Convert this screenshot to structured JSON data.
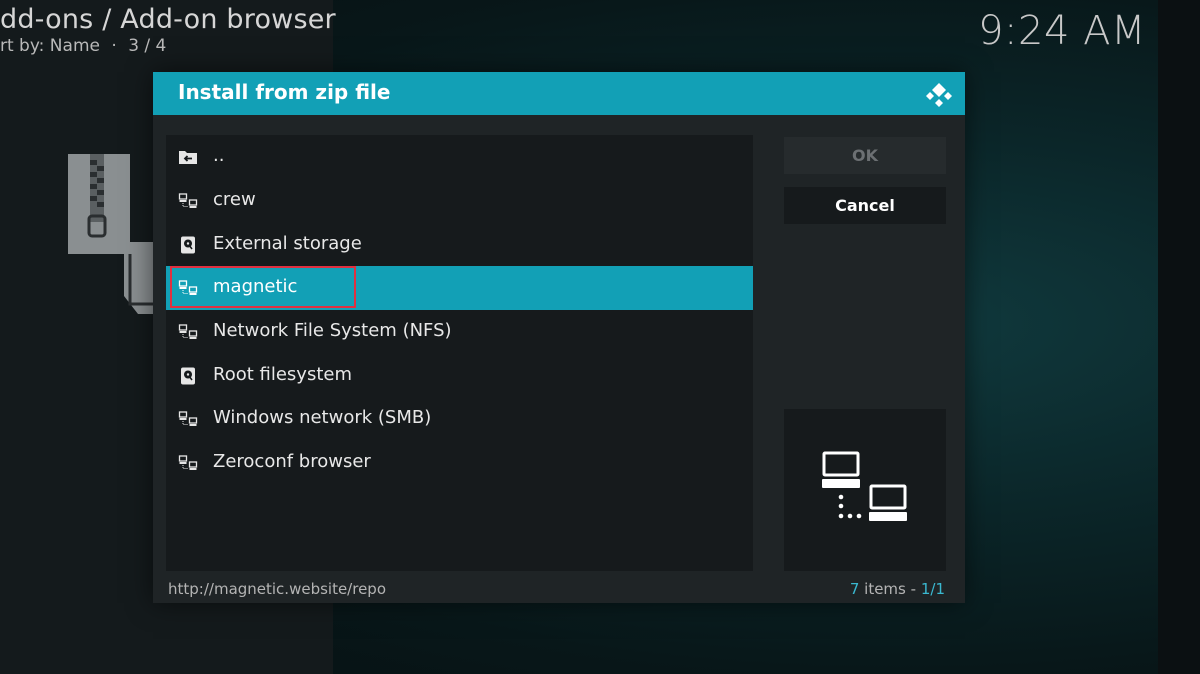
{
  "header": {
    "title": "dd-ons / Add-on browser",
    "sort_text": "rt by: Name",
    "separator": "·",
    "position": "3 / 4",
    "clock": "9:24 AM"
  },
  "dialog": {
    "title": "Install from zip file",
    "logo_icon": "kodi-logo-icon",
    "items": [
      {
        "label": "..",
        "icon": "folder-back-icon"
      },
      {
        "label": "crew",
        "icon": "network-icon"
      },
      {
        "label": "External storage",
        "icon": "hard-drive-icon"
      },
      {
        "label": "magnetic",
        "icon": "network-icon",
        "selected": true
      },
      {
        "label": "Network File System (NFS)",
        "icon": "network-icon"
      },
      {
        "label": "Root filesystem",
        "icon": "hard-drive-icon"
      },
      {
        "label": "Windows network (SMB)",
        "icon": "network-icon"
      },
      {
        "label": "Zeroconf browser",
        "icon": "network-icon"
      }
    ],
    "ok_label": "OK",
    "cancel_label": "Cancel",
    "preview_icon": "network-computers-icon",
    "footer_path": "http://magnetic.website/repo",
    "footer_count": {
      "count": "7",
      "count_label": "items",
      "separator": "-",
      "page": "1/1"
    }
  },
  "colors": {
    "accent": "#12a0b6",
    "highlight_border": "#e03040",
    "dialog_bg": "#1f2426",
    "list_bg": "#161a1c"
  }
}
